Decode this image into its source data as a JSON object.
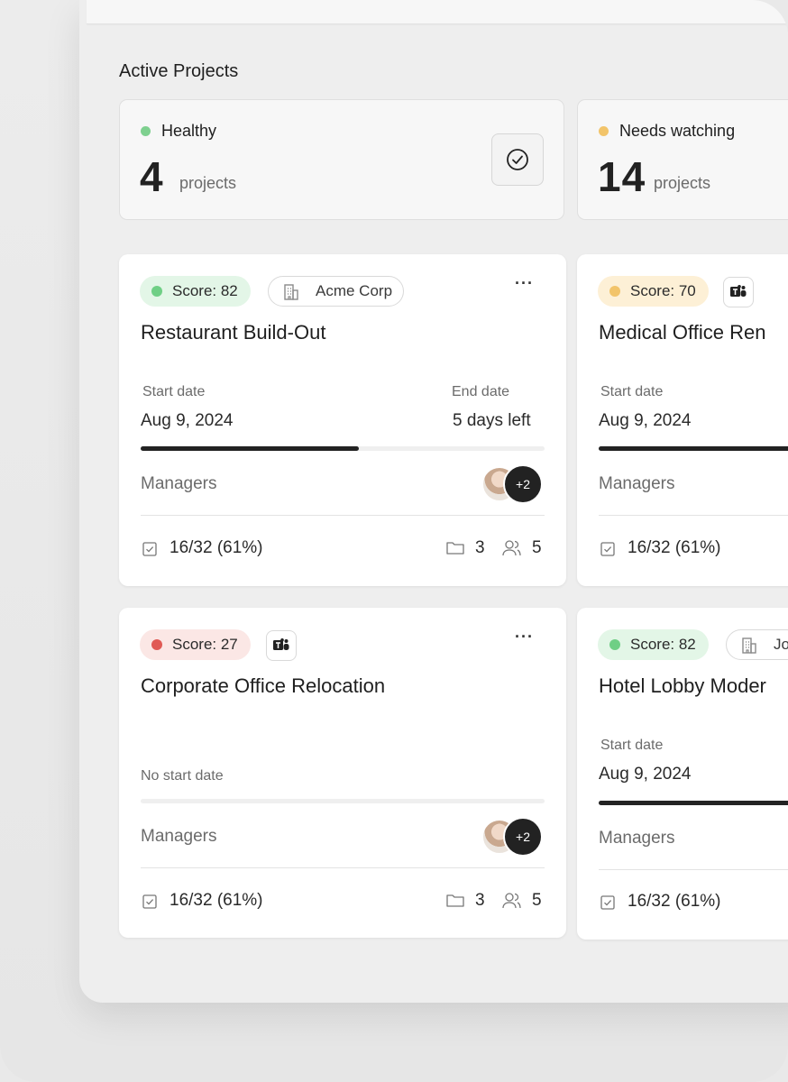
{
  "section_title": "Active Projects",
  "summaries": [
    {
      "label": "Healthy",
      "count": "4",
      "unit": "projects",
      "dot_color": "#7ed08f"
    },
    {
      "label": "Needs watching",
      "count": "14",
      "unit": "projects",
      "dot_color": "#f2c46a"
    }
  ],
  "cards": [
    {
      "score": "Score: 82",
      "score_bg": "#e3f6e7",
      "score_dot": "#6fcf85",
      "client": "Acme Corp",
      "title": "Restaurant Build-Out",
      "start_label": "Start date",
      "start_value": "Aug 9, 2024",
      "end_label": "End date",
      "end_value": "5 days left",
      "progress": 0.54,
      "managers_label": "Managers",
      "managers_more": "+2",
      "tasks": "16/32 (61%)",
      "folders": "3",
      "people": "5"
    },
    {
      "score": "Score: 70",
      "score_bg": "#fdf0d6",
      "score_dot": "#f2c46a",
      "title": "Medical Office Ren",
      "start_label": "Start date",
      "start_value": "Aug 9, 2024",
      "managers_label": "Managers",
      "tasks": "16/32 (61%)"
    },
    {
      "score": "Score: 27",
      "score_bg": "#fbe7e5",
      "score_dot": "#e05a55",
      "title": "Corporate Office Relocation",
      "no_start": "No start date",
      "progress": 0.0,
      "managers_label": "Managers",
      "managers_more": "+2",
      "tasks": "16/32 (61%)",
      "folders": "3",
      "people": "5"
    },
    {
      "score": "Score: 82",
      "score_bg": "#e3f6e7",
      "score_dot": "#6fcf85",
      "client": "Jo",
      "title": "Hotel Lobby Moder",
      "start_label": "Start date",
      "start_value": "Aug 9, 2024",
      "managers_label": "Managers",
      "tasks": "16/32 (61%)"
    }
  ]
}
